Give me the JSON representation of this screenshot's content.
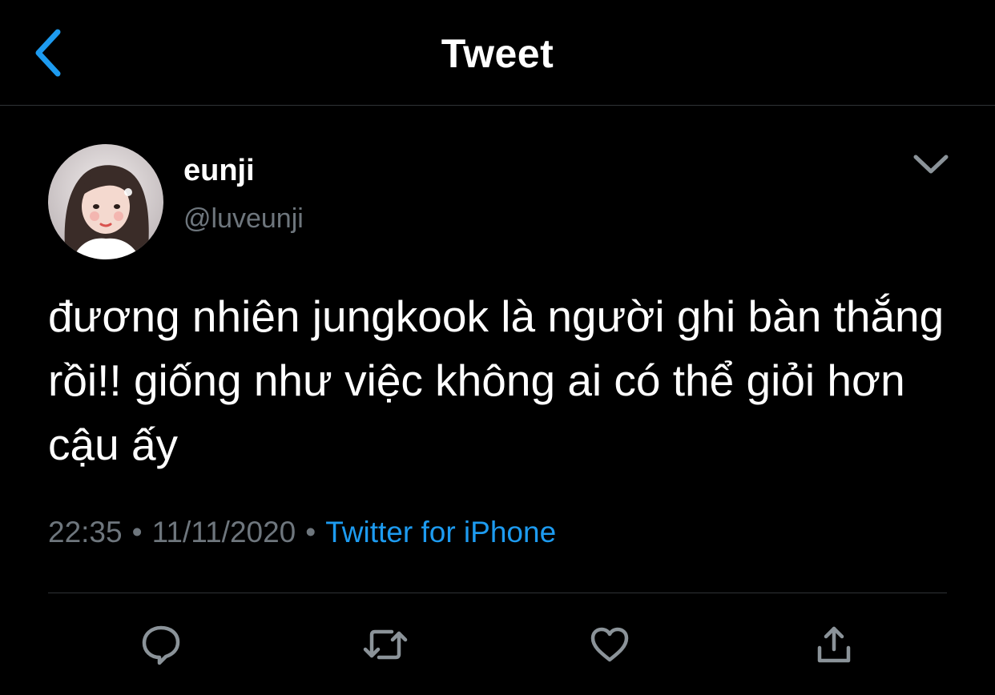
{
  "nav": {
    "title": "Tweet",
    "back_icon": "chevron-left-icon"
  },
  "tweet": {
    "author": {
      "display_name": "eunji",
      "handle": "@luveunji",
      "avatar_icon": "avatar-photo"
    },
    "text": "đương nhiên jungkook là người ghi bàn thắng rồi!! giống như việc không ai có thể giỏi hơn cậu ấy",
    "time": "22:35",
    "date": "11/11/2020",
    "separator": "•",
    "source": "Twitter for iPhone",
    "menu_icon": "chevron-down-icon"
  },
  "actions": [
    {
      "icon": "reply-icon"
    },
    {
      "icon": "retweet-icon"
    },
    {
      "icon": "like-icon"
    },
    {
      "icon": "share-icon"
    }
  ],
  "colors": {
    "background": "#000000",
    "text_primary": "#ffffff",
    "text_secondary": "#6e767d",
    "accent": "#1d9bf0",
    "divider": "#2f3336"
  }
}
